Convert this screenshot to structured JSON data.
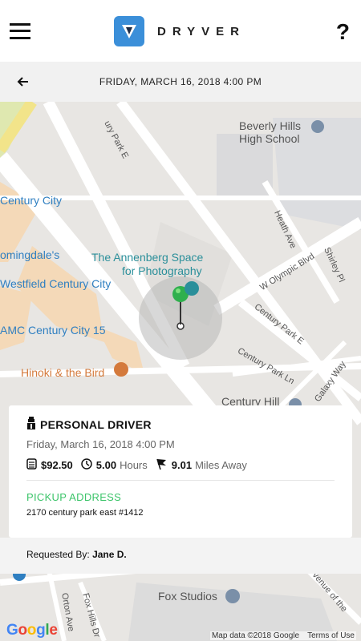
{
  "header": {
    "brand_name": "DRYVER",
    "help_label": "?"
  },
  "date_bar": {
    "date_time": "FRIDAY, MARCH 16, 2018 4:00 PM"
  },
  "map": {
    "labels": {
      "high_school_line1": "Beverly Hills",
      "high_school_line2": "High School",
      "century_city": "Century City",
      "bloomingdales": "omingdale's",
      "annenberg_line1": "The Annenberg Space",
      "annenberg_line2": "for Photography",
      "westfield": "Westfield Century City",
      "amc": "AMC Century City 15",
      "hinoki": "Hinoki & the Bird",
      "century_hill": "Century Hill",
      "fox_studios": "Fox Studios",
      "century_park_e_top": "ury Park E",
      "century_park_e_right": "Century Park E",
      "w_olympic": "W Olympic Blvd",
      "heath_ave": "Heath Ave",
      "shirley_pl": "Shirley Pl",
      "century_park_ln": "Century Park Ln",
      "galaxy_way": "Galaxy Way",
      "orton_ave": "Orton Ave",
      "fox_hills_dr": "Fox Hills Dr",
      "avenue_of_the": "venue of the"
    },
    "attribution": {
      "google": "Google",
      "map_data": "Map data ©2018 Google",
      "terms": "Terms of Use"
    }
  },
  "booking": {
    "service_type": "PERSONAL DRIVER",
    "date_time": "Friday, March 16, 2018 4:00 PM",
    "price": "$92.50",
    "hours_value": "5.00",
    "hours_unit": "Hours",
    "miles_value": "9.01",
    "miles_unit": "Miles Away",
    "pickup_label": "PICKUP ADDRESS",
    "pickup_address": "2170 century park east #1412"
  },
  "requested": {
    "label": "Requested By:",
    "name": "Jane D."
  },
  "colors": {
    "brand_blue": "#3b8fd9",
    "pickup_green": "#3cc46a",
    "pin_green": "#2fb04d"
  },
  "icons": {
    "menu": "hamburger-menu-icon",
    "back": "arrow-left-icon",
    "driver": "driver-icon",
    "money": "cash-icon",
    "clock": "clock-icon",
    "distance": "flag-icon",
    "pin": "map-pin-icon"
  }
}
